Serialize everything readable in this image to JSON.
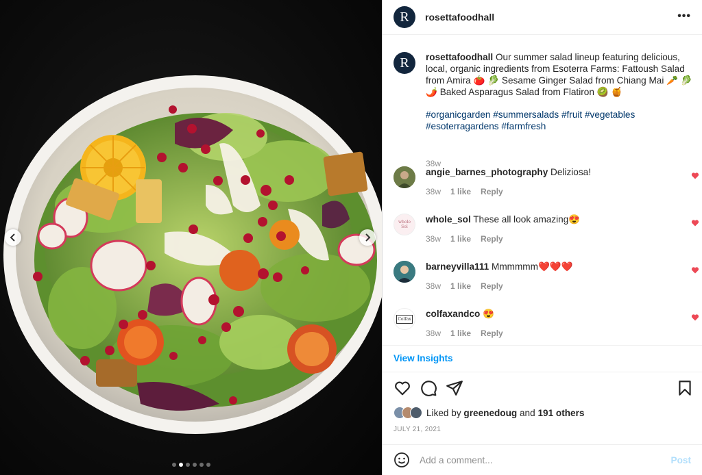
{
  "post": {
    "username": "rosettafoodhall",
    "avatar_letter": "R",
    "caption_text": "Our summer salad lineup featuring delicious, local, organic ingredients from Esoterra Farms: Fattoush Salad from Amira 🍅 🥬 Sesame Ginger Salad from Chiang Mai 🥕 🥬 🌶️ Baked Asparagus Salad from Flatiron 🥝 🍯",
    "hashtags_line1": "#organicgarden #summersalads #fruit #vegetables",
    "hashtags_line2": "#esoterragardens #farmfresh",
    "caption_time": "38w",
    "more_icon": "more-horizontal-icon"
  },
  "media": {
    "photo": "salad-in-white-bowl",
    "carousel_count": 6,
    "carousel_active": 2
  },
  "comments": [
    {
      "user": "angie_barnes_photography",
      "text": "Deliziosa!",
      "time": "38w",
      "likes": "1 like",
      "reply": "Reply"
    },
    {
      "user": "whole_sol",
      "text": "These all look amazing😍",
      "time": "38w",
      "likes": "1 like",
      "reply": "Reply",
      "avatar_text": "whole Sol"
    },
    {
      "user": "barneyvilla111",
      "text": "Mmmmmm❤️❤️❤️",
      "time": "38w",
      "likes": "1 like",
      "reply": "Reply"
    },
    {
      "user": "colfaxandco",
      "text": "😍",
      "time": "38w",
      "likes": "1 like",
      "reply": "Reply",
      "avatar_text": "Colfax"
    }
  ],
  "insights_label": "View Insights",
  "likes": {
    "prefix": "Liked by",
    "user": "greenedoug",
    "middle": "and",
    "others": "191 others"
  },
  "date": "JULY 21, 2021",
  "add_comment": {
    "placeholder": "Add a comment...",
    "post_label": "Post"
  },
  "colors": {
    "accent": "#0095f6",
    "heart": "#ed4956",
    "post_disabled": "#b2dffc",
    "link": "#00376b"
  }
}
